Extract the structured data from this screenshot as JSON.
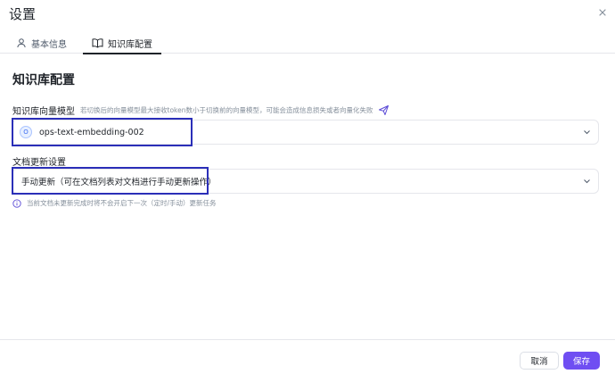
{
  "dialog": {
    "title": "设置"
  },
  "tabs": [
    {
      "label": "基本信息",
      "icon": "user-icon"
    },
    {
      "label": "知识库配置",
      "icon": "book-icon",
      "active": true
    }
  ],
  "section": {
    "title": "知识库配置"
  },
  "vector_model": {
    "label": "知识库向量模型",
    "hint": "若切换后的向量模型最大接收token数小于切换前的向量模型，可能会造成信息损失或者向量化失败",
    "value": "ops-text-embedding-002",
    "badge": "O"
  },
  "doc_update": {
    "label": "文档更新设置",
    "value": "手动更新（可在文档列表对文档进行手动更新操作）",
    "note": "当前文档未更新完成时将不会开启下一次（定时/手动）更新任务"
  },
  "footer": {
    "cancel_label": "取消",
    "save_label": "保存"
  },
  "colors": {
    "primary": "#6f4ef2",
    "highlight": "#2b2fb8",
    "muted": "#86909c"
  }
}
